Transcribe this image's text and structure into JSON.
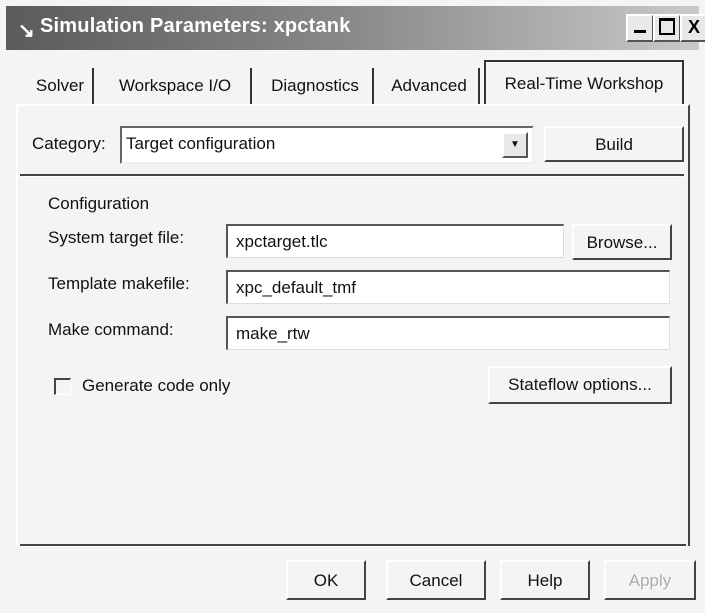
{
  "window": {
    "title": "Simulation Parameters: xpctank",
    "app_icon": "simulink-icon",
    "minimize_icon": "minimize-icon",
    "maximize_icon": "maximize-icon",
    "close_label": "X"
  },
  "tabs": [
    {
      "label": "Solver"
    },
    {
      "label": "Workspace I/O"
    },
    {
      "label": "Diagnostics"
    },
    {
      "label": "Advanced"
    },
    {
      "label": "Real-Time Workshop",
      "active": true
    }
  ],
  "category": {
    "label": "Category:",
    "value": "Target configuration",
    "build_label": "Build"
  },
  "configuration": {
    "heading": "Configuration",
    "system_target_label": "System target file:",
    "system_target_value": "xpctarget.tlc",
    "browse_label": "Browse...",
    "template_makefile_label": "Template makefile:",
    "template_makefile_value": "xpc_default_tmf",
    "make_command_label": "Make command:",
    "make_command_value": "make_rtw",
    "generate_code_only_label": "Generate code only",
    "generate_code_only_checked": false,
    "stateflow_options_label": "Stateflow options..."
  },
  "footer": {
    "ok_label": "OK",
    "cancel_label": "Cancel",
    "help_label": "Help",
    "apply_label": "Apply"
  }
}
